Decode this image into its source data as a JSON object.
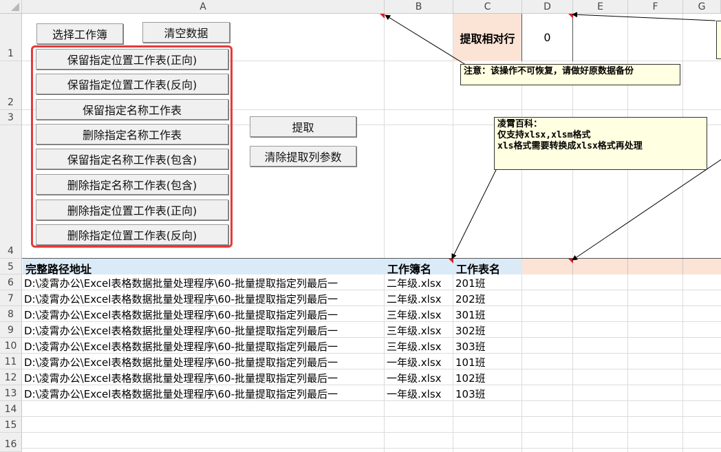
{
  "columns": [
    "A",
    "B",
    "C",
    "D",
    "E",
    "F",
    "G"
  ],
  "rows": [
    "1",
    "2",
    "3",
    "4",
    "5",
    "6",
    "7",
    "8",
    "9",
    "10",
    "11",
    "12",
    "13",
    "14",
    "15",
    "16"
  ],
  "buttons": {
    "select_workbook": "选择工作簿",
    "clear_data": "清空数据",
    "extract": "提取",
    "clear_params": "清除提取列参数",
    "group": [
      "保留指定位置工作表(正向)",
      "保留指定位置工作表(反向)",
      "保留指定名称工作表",
      "删除指定名称工作表",
      "保留指定名称工作表(包含)",
      "删除指定名称工作表(包含)",
      "删除指定位置工作表(正向)",
      "删除指定位置工作表(反向)"
    ]
  },
  "param": {
    "label": "提取相对行",
    "value": "0"
  },
  "notes": {
    "warning": "注意：该操作不可恢复，请做好原数据备份",
    "info_title": "凌霄百科：",
    "info_line1": "仅支持xlsx,xlsm格式",
    "info_line2": "xls格式需要转换成xlsx格式再处理"
  },
  "table": {
    "headers": [
      "完整路径地址",
      "工作簿名",
      "工作表名"
    ],
    "rows": [
      [
        "D:\\凌霄办公\\Excel表格数据批量处理程序\\60-批量提取指定列最后一",
        "二年级.xlsx",
        "201班"
      ],
      [
        "D:\\凌霄办公\\Excel表格数据批量处理程序\\60-批量提取指定列最后一",
        "二年级.xlsx",
        "202班"
      ],
      [
        "D:\\凌霄办公\\Excel表格数据批量处理程序\\60-批量提取指定列最后一",
        "三年级.xlsx",
        "301班"
      ],
      [
        "D:\\凌霄办公\\Excel表格数据批量处理程序\\60-批量提取指定列最后一",
        "三年级.xlsx",
        "302班"
      ],
      [
        "D:\\凌霄办公\\Excel表格数据批量处理程序\\60-批量提取指定列最后一",
        "三年级.xlsx",
        "303班"
      ],
      [
        "D:\\凌霄办公\\Excel表格数据批量处理程序\\60-批量提取指定列最后一",
        "一年级.xlsx",
        "101班"
      ],
      [
        "D:\\凌霄办公\\Excel表格数据批量处理程序\\60-批量提取指定列最后一",
        "一年级.xlsx",
        "102班"
      ],
      [
        "D:\\凌霄办公\\Excel表格数据批量处理程序\\60-批量提取指定列最后一",
        "一年级.xlsx",
        "103班"
      ]
    ]
  },
  "colors": {
    "header_blue": "#dbeaf7",
    "header_peach": "#fbe3d6",
    "note_bg": "#ffffe1",
    "group_border": "#e53a3a"
  }
}
